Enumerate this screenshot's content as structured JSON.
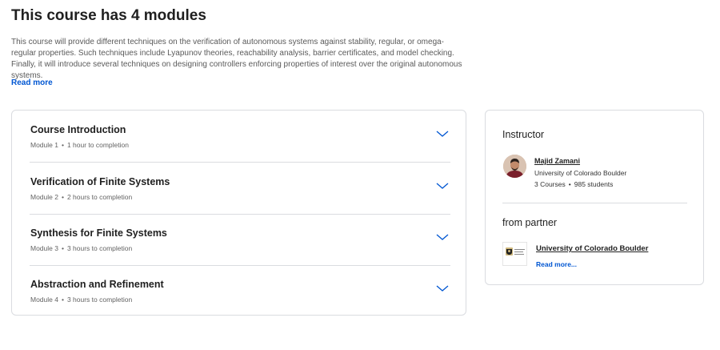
{
  "heading": "This course has 4 modules",
  "description": "This course will provide different techniques on the verification of autonomous systems against stability, regular, or omega-regular properties. Such techniques include Lyapunov theories, reachability analysis, barrier certificates, and model checking. Finally, it will introduce several techniques on designing controllers enforcing properties of interest over the original autonomous systems.",
  "read_more": "Read more",
  "modules": [
    {
      "title": "Course Introduction",
      "module": "Module 1",
      "duration": "1 hour to completion"
    },
    {
      "title": "Verification of Finite Systems",
      "module": "Module 2",
      "duration": "2 hours to completion"
    },
    {
      "title": "Synthesis for Finite Systems",
      "module": "Module 3",
      "duration": "3 hours to completion"
    },
    {
      "title": "Abstraction and Refinement",
      "module": "Module 4",
      "duration": "3 hours to completion"
    }
  ],
  "instructor": {
    "heading": "Instructor",
    "name": "Majid Zamani",
    "org": "University of Colorado Boulder",
    "courses": "3 Courses",
    "students": "985 students"
  },
  "partner": {
    "heading": "from partner",
    "name": "University of Colorado Boulder",
    "read_more": "Read more...",
    "logo_text": "University of Colorado Boulder"
  },
  "colors": {
    "link": "#0056d2",
    "border": "#dadce0",
    "chevron": "#0056d2"
  }
}
